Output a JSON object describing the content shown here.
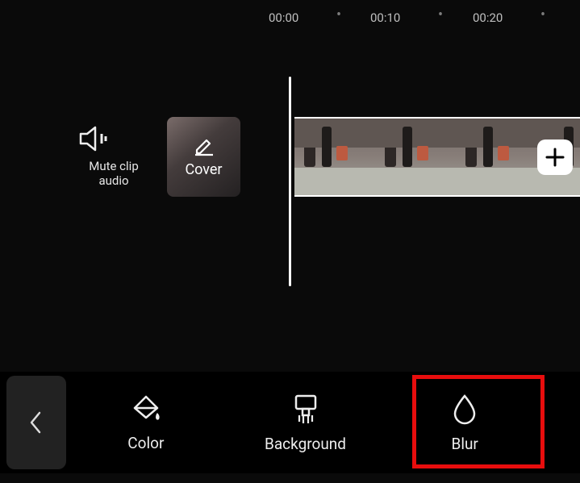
{
  "timeline": {
    "ticks": [
      "00:00",
      "00:10",
      "00:20"
    ]
  },
  "controls": {
    "mute_label": "Mute clip audio",
    "cover_label": "Cover"
  },
  "tools": {
    "color_label": "Color",
    "background_label": "Background",
    "blur_label": "Blur"
  },
  "icons": {
    "add": "+"
  }
}
